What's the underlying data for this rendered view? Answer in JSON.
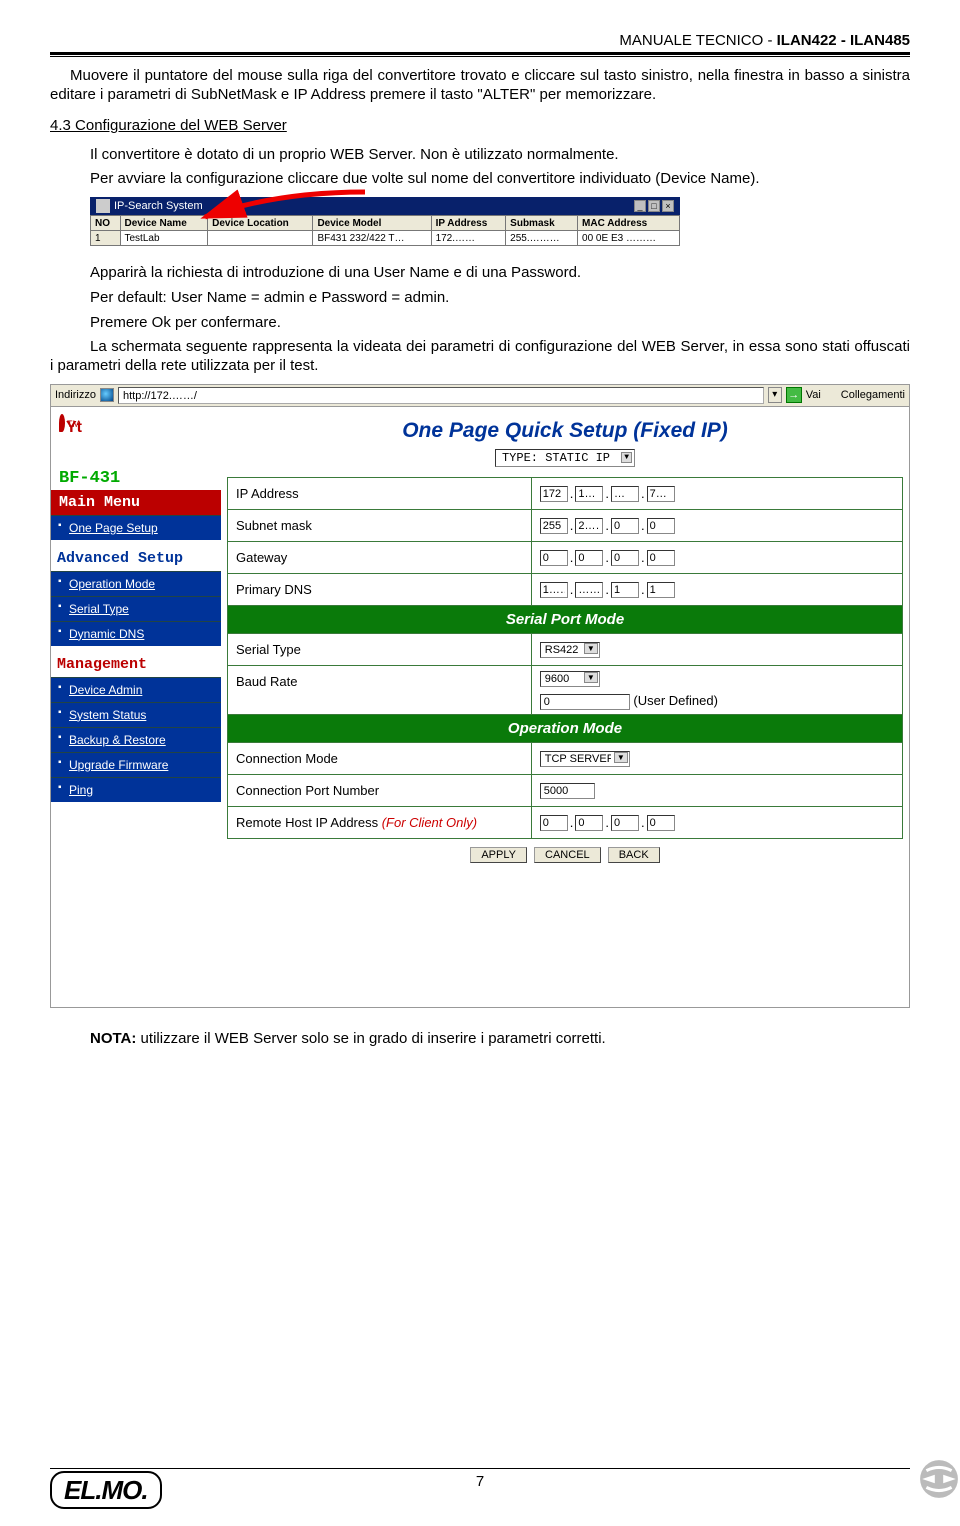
{
  "header": {
    "title_plain": "MANUALE TECNICO  -  ",
    "title_bold": "ILAN422  -  ILAN485"
  },
  "body": {
    "p1": "Muovere il puntatore del mouse sulla riga del convertitore trovato e cliccare sul tasto sinistro, nella finestra in basso a  sinistra editare i parametri di SubNetMask e IP Address premere il tasto \"ALTER\" per memorizzare.",
    "sec": "4.3 Configurazione del WEB Server",
    "p2": "Il convertitore è dotato di un proprio WEB Server. Non è utilizzato normalmente.",
    "p3": "Per avviare la configurazione cliccare due volte sul nome del convertitore individuato (Device Name).",
    "p4": "Apparirà la richiesta di introduzione di una User Name e di una Password.",
    "p5": "Per default: User Name = admin e Password = admin.",
    "p6": "Premere Ok per confermare.",
    "p7": "La schermata seguente rappresenta la videata dei parametri di configurazione del WEB Server, in essa sono stati offuscati i parametri della rete utilizzata  per il test.",
    "nota_b": "NOTA:",
    "nota": " utilizzare il WEB Server solo se in grado di inserire i parametri corretti."
  },
  "shot1": {
    "title": "IP-Search System",
    "headers": [
      "NO",
      "Device Name",
      "Device Location",
      "Device Model",
      "IP Address",
      "Submask",
      "MAC Address"
    ],
    "row": [
      "1",
      "TestLab",
      "",
      "BF431 232/422 T…",
      "172.……",
      "255.………",
      "00 0E E3 ………"
    ]
  },
  "shot2": {
    "addr_label": "Indirizzo",
    "url": "http://172.……/",
    "vai": "Vai",
    "coll": "Collegamenti",
    "bf": "BF-431",
    "mainmenu": "Main Menu",
    "one_page": "One Page Setup",
    "adv": "Advanced Setup",
    "adv_items": [
      "Operation Mode",
      "Serial Type",
      "Dynamic DNS"
    ],
    "mgmt": "Management",
    "mgmt_items": [
      "Device Admin",
      "System Status",
      "Backup & Restore",
      "Upgrade Firmware",
      "Ping"
    ],
    "qs_title": "One Page Quick Setup (Fixed IP)",
    "type_label": "TYPE: STATIC IP",
    "rows": {
      "ip": "IP Address",
      "ip_v": [
        "172",
        "1…",
        "…",
        "7…"
      ],
      "sub": "Subnet mask",
      "sub_v": [
        "255",
        "2……",
        "0",
        "0"
      ],
      "gw": "Gateway",
      "gw_v": [
        "0",
        "0",
        "0",
        "0"
      ],
      "dns": "Primary DNS",
      "dns_v": [
        "1……",
        "……",
        "1",
        "1"
      ],
      "sec1": "Serial Port Mode",
      "stype": "Serial Type",
      "stype_v": "RS422",
      "baud": "Baud Rate",
      "baud_v": "9600",
      "baud_ud_v": "0",
      "baud_ud": "(User Defined)",
      "sec2": "Operation Mode",
      "cmode": "Connection Mode",
      "cmode_v": "TCP SERVER",
      "cport": "Connection Port Number",
      "cport_v": "5000",
      "rhost": "Remote Host  IP Address ",
      "rhost_red": "(For Client Only)",
      "rhost_v": [
        "0",
        "0",
        "0",
        "0"
      ]
    },
    "btns": [
      "APPLY",
      "CANCEL",
      "BACK"
    ]
  },
  "footer": {
    "page": "7",
    "logo": "EL.MO."
  }
}
